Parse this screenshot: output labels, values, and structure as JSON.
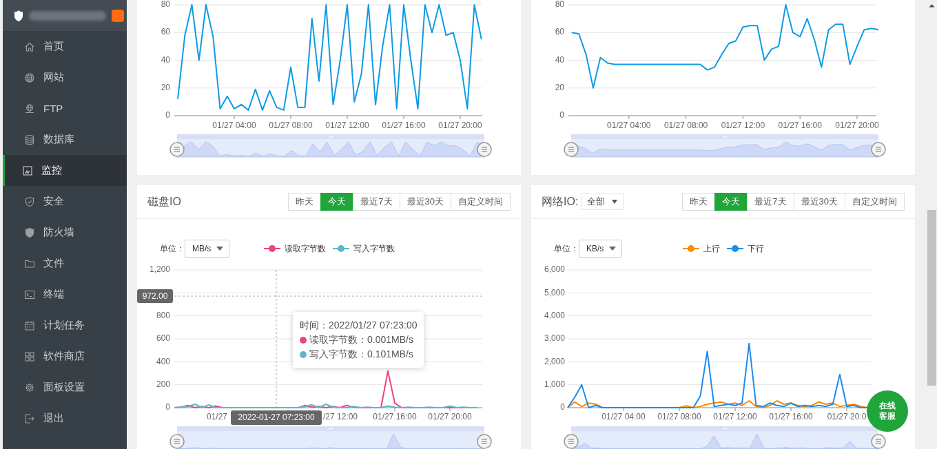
{
  "sidebar": {
    "items": [
      {
        "label": "首页",
        "selected": false
      },
      {
        "label": "网站",
        "selected": false
      },
      {
        "label": "FTP",
        "selected": false
      },
      {
        "label": "数据库",
        "selected": false
      },
      {
        "label": "监控",
        "selected": true
      },
      {
        "label": "安全",
        "selected": false
      },
      {
        "label": "防火墙",
        "selected": false
      },
      {
        "label": "文件",
        "selected": false
      },
      {
        "label": "终端",
        "selected": false
      },
      {
        "label": "计划任务",
        "selected": false
      },
      {
        "label": "软件商店",
        "selected": false
      },
      {
        "label": "面板设置",
        "selected": false
      },
      {
        "label": "退出",
        "selected": false
      }
    ]
  },
  "upper_charts": [
    {
      "chart_data": {
        "type": "line",
        "categories": [
          null,
          null,
          null,
          null,
          null,
          null,
          null,
          null,
          "01/27 04:00",
          null,
          null,
          null,
          null,
          null,
          null,
          null,
          "01/27 08:00",
          null,
          null,
          null,
          null,
          null,
          null,
          null,
          "01/27 12:00",
          null,
          null,
          null,
          null,
          null,
          null,
          null,
          "01/27 16:00",
          null,
          null,
          null,
          null,
          null,
          null,
          null,
          "01/27 20:00",
          null,
          null,
          null
        ],
        "yticks": [
          {
            "value": 0,
            "label": "0"
          },
          {
            "value": 20,
            "label": "20"
          },
          {
            "value": 40,
            "label": "40"
          },
          {
            "value": 60,
            "label": "60"
          },
          {
            "value": 80,
            "label": "80"
          }
        ],
        "ylim": [
          0,
          80
        ],
        "grid": true,
        "series": [
          {
            "color": "#0e9be5",
            "values": [
              12,
              58,
              80,
              40,
              80,
              57,
              5,
              14,
              5,
              8,
              4,
              19,
              4,
              18,
              6,
              4,
              35,
              6,
              6,
              70,
              25,
              80,
              8,
              40,
              80,
              10,
              30,
              80,
              8,
              50,
              80,
              5,
              80,
              40,
              5,
              80,
              60,
              80,
              58,
              60,
              40,
              5,
              80,
              55
            ]
          }
        ]
      }
    },
    {
      "chart_data": {
        "type": "line",
        "categories": [
          null,
          null,
          null,
          null,
          null,
          null,
          null,
          null,
          "01/27 04:00",
          null,
          null,
          null,
          null,
          null,
          null,
          null,
          "01/27 08:00",
          null,
          null,
          null,
          null,
          null,
          null,
          null,
          "01/27 12:00",
          null,
          null,
          null,
          null,
          null,
          null,
          null,
          "01/27 16:00",
          null,
          null,
          null,
          null,
          null,
          null,
          null,
          "01/27 20:00",
          null,
          null,
          null
        ],
        "yticks": [
          {
            "value": 0,
            "label": "0"
          },
          {
            "value": 20,
            "label": "20"
          },
          {
            "value": 40,
            "label": "40"
          },
          {
            "value": 60,
            "label": "60"
          },
          {
            "value": 80,
            "label": "80"
          }
        ],
        "ylim": [
          0,
          80
        ],
        "grid": true,
        "series": [
          {
            "color": "#0e9be5",
            "values": [
              60,
              59,
              44,
              20,
              42,
              38,
              37,
              37,
              37,
              37,
              37,
              37,
              37,
              37,
              37,
              37,
              37,
              37,
              37,
              33,
              35,
              44,
              52,
              54,
              64,
              65,
              65,
              40,
              48,
              50,
              80,
              60,
              57,
              70,
              55,
              35,
              62,
              66,
              66,
              37,
              50,
              62,
              63,
              62
            ]
          }
        ]
      }
    }
  ],
  "disk_io": {
    "title": "磁盘IO",
    "ranges": [
      {
        "label": "昨天",
        "selected": false
      },
      {
        "label": "今天",
        "selected": true
      },
      {
        "label": "最近7天",
        "selected": false
      },
      {
        "label": "最近30天",
        "selected": false
      },
      {
        "label": "自定义时间",
        "selected": false
      }
    ],
    "unit_label": "单位：",
    "unit": "MB/s",
    "chart_data": {
      "type": "line",
      "categories": [
        null,
        null,
        null,
        null,
        null,
        null,
        null,
        null,
        null,
        null,
        null,
        null,
        null,
        null,
        null,
        null,
        null,
        null,
        null,
        null,
        null,
        null,
        null,
        null,
        null,
        null,
        null,
        null,
        null,
        null,
        null,
        null,
        "01/27 16:00",
        null,
        null,
        null,
        null,
        null,
        null,
        null,
        "01/27 20:00",
        null,
        null,
        null,
        null
      ],
      "yticks": [
        0,
        200,
        400,
        600,
        800,
        {
          "value": 1200,
          "label": "1,200"
        }
      ],
      "ylim": [
        0,
        1200
      ],
      "grid": true,
      "series": [
        {
          "name": "读取字节数",
          "color": "#f0437e",
          "values": [
            0,
            5,
            20,
            0,
            10,
            0,
            15,
            0,
            0,
            0,
            0,
            0,
            0,
            0,
            0,
            0,
            0,
            0,
            0,
            20,
            5,
            10,
            0,
            10,
            0,
            20,
            5,
            0,
            0,
            0,
            0,
            320,
            40,
            0,
            0,
            0,
            0,
            0,
            0,
            0,
            0,
            0,
            0,
            null,
            null
          ]
        },
        {
          "name": "写入字节数",
          "color": "#5ab8c8",
          "values": [
            0,
            5,
            10,
            30,
            0,
            25,
            0,
            0,
            0,
            0,
            0,
            0,
            0,
            0,
            0,
            0,
            0,
            0,
            0,
            10,
            25,
            0,
            30,
            5,
            0,
            0,
            10,
            0,
            5,
            0,
            0,
            15,
            5,
            0,
            5,
            0,
            0,
            5,
            0,
            0,
            15,
            0,
            5,
            0,
            0
          ]
        }
      ],
      "ref_lines": [
        {
          "axis": "y",
          "value": 972,
          "label": "972.00"
        }
      ]
    },
    "axis_pointer": {
      "label": "2022-01-27 07:23:00"
    },
    "covered_axis_labels": [
      "01/27",
      "/27 12:00"
    ],
    "tooltip": {
      "title": "时间：2022/01/27 07:23:00",
      "items": [
        {
          "label": "读取字节数：0.001MB/s",
          "color": "#f0437e"
        },
        {
          "label": "写入字节数：0.101MB/s",
          "color": "#5ab8c8"
        }
      ]
    }
  },
  "network_io": {
    "title": "网络IO:",
    "filter": "全部",
    "ranges": [
      {
        "label": "昨天",
        "selected": false
      },
      {
        "label": "今天",
        "selected": true
      },
      {
        "label": "最近7天",
        "selected": false
      },
      {
        "label": "最近30天",
        "selected": false
      },
      {
        "label": "自定义时间",
        "selected": false
      }
    ],
    "unit_label": "单位：",
    "unit": "KB/s",
    "chart_data": {
      "type": "line",
      "categories": [
        null,
        null,
        null,
        null,
        null,
        null,
        null,
        null,
        "01/27 04:00",
        null,
        null,
        null,
        null,
        null,
        null,
        null,
        "01/27 08:00",
        null,
        null,
        null,
        null,
        null,
        null,
        null,
        "01/27 12:00",
        null,
        null,
        null,
        null,
        null,
        null,
        null,
        "01/27 16:00",
        null,
        null,
        null,
        null,
        null,
        null,
        null,
        "01/27 20:0",
        null,
        null,
        null
      ],
      "yticks": [
        0,
        {
          "value": 1000,
          "label": "1,000"
        },
        {
          "value": 2000,
          "label": "2,000"
        },
        {
          "value": 3000,
          "label": "3,000"
        },
        {
          "value": 4000,
          "label": "4,000"
        },
        {
          "value": 5000,
          "label": "5,000"
        },
        {
          "value": 6000,
          "label": "6,000"
        }
      ],
      "ylim": [
        0,
        6000
      ],
      "grid": true,
      "series": [
        {
          "name": "上行",
          "color": "#ff8a00",
          "values": [
            0,
            250,
            50,
            200,
            150,
            0,
            0,
            0,
            0,
            0,
            0,
            0,
            0,
            0,
            0,
            0,
            0,
            80,
            0,
            50,
            150,
            200,
            250,
            150,
            200,
            100,
            300,
            50,
            0,
            100,
            300,
            150,
            200,
            100,
            50,
            100,
            250,
            150,
            200,
            50,
            100,
            150,
            50,
            0
          ]
        },
        {
          "name": "下行",
          "color": "#1b8cf0",
          "values": [
            0,
            450,
            1000,
            0,
            100,
            0,
            0,
            0,
            0,
            0,
            0,
            0,
            0,
            0,
            0,
            0,
            0,
            0,
            0,
            500,
            2450,
            50,
            100,
            150,
            100,
            200,
            2800,
            100,
            50,
            200,
            100,
            50,
            200,
            50,
            100,
            50,
            100,
            50,
            150,
            1450,
            50,
            100,
            0,
            0
          ]
        }
      ]
    }
  },
  "chat_button": {
    "label": "在线客服"
  }
}
